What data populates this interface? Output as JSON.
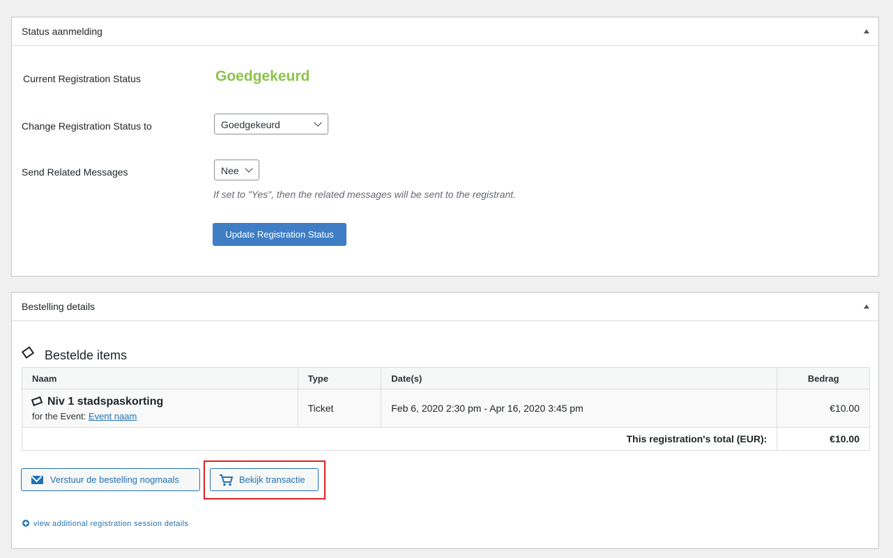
{
  "status_box": {
    "title": "Status aanmelding",
    "current_label": "Current Registration Status",
    "current_value": "Goedgekeurd",
    "change_label": "Change Registration Status to",
    "change_selected": "Goedgekeurd",
    "send_label": "Send Related Messages",
    "send_selected": "Nee",
    "send_hint": "If set to \"Yes\", then the related messages will be sent to the registrant.",
    "update_button": "Update Registration Status"
  },
  "order_box": {
    "title": "Bestelling details",
    "section_title": "Bestelde items",
    "table": {
      "headers": {
        "name": "Naam",
        "type": "Type",
        "dates": "Date(s)",
        "amount": "Bedrag"
      },
      "rows": [
        {
          "name": "Niv 1 stadspaskorting",
          "event_prefix": "for the Event:",
          "event_link": "Event naam",
          "type": "Ticket",
          "dates": "Feb 6, 2020 2:30 pm - Apr 16, 2020 3:45 pm",
          "amount": "€10.00"
        }
      ],
      "total_label": "This registration's total (EUR):",
      "total_value": "€10.00"
    },
    "resend_button": "Verstuur de bestelling nogmaals",
    "view_transaction_button": "Bekijk transactie",
    "more_link": "view additional registration session details"
  },
  "colors": {
    "status_green": "#8bc34a",
    "primary_blue": "#3f7ec4",
    "link_blue": "#2271b1",
    "highlight_red": "#e01e1e"
  }
}
